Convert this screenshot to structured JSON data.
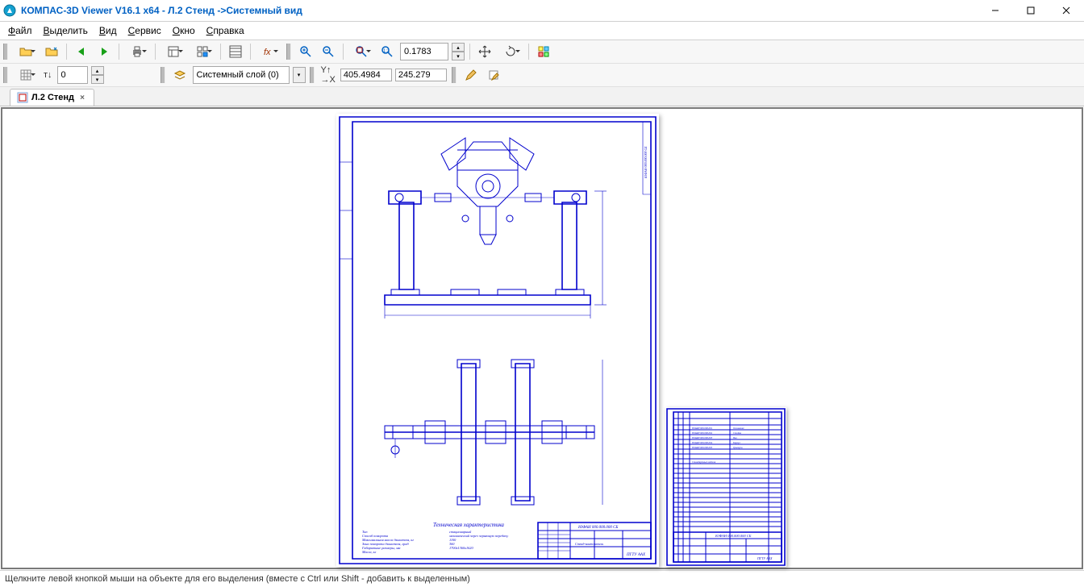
{
  "title": "КОМПАС-3D Viewer V16.1 x64 - Л.2 Стенд ->Системный вид",
  "menu": {
    "file": "Файл",
    "select": "Выделить",
    "view": "Вид",
    "service": "Сервис",
    "window": "Окно",
    "help": "Справка"
  },
  "toolbar": {
    "scale_value": "0.1783",
    "layer_value": "Системный слой (0)",
    "step_value": "0",
    "coord_x": "405.4984",
    "coord_y": "245.279"
  },
  "tab": {
    "name": "Л.2 Стенд"
  },
  "drawing": {
    "tech_title": "Техническая характеристика",
    "tech_rows": [
      {
        "k": "Тип",
        "v": "стационарный"
      },
      {
        "k": "Способ поворота",
        "v": "механический через червячную передачу"
      },
      {
        "k": "Максимальная масса двигателя, кг",
        "v": "1100"
      },
      {
        "k": "Зона поворота двигателя, град",
        "v": "360"
      },
      {
        "k": "Габаритные размеры, мм",
        "v": "1700x1360x1620"
      },
      {
        "k": "Масса, кг",
        "v": ""
      }
    ],
    "title_block_code_1": "ЮФАН 000.000.000 СБ",
    "title_block_note": "Стенд-кантователь",
    "title_block_code_2": "ЮФАН 000.000.000 СБ",
    "title_block_org": "ПГТУ ААХ"
  },
  "status_text": "Щелкните левой кнопкой мыши на объекте для его выделения (вместе с Ctrl или Shift - добавить к выделенным)"
}
